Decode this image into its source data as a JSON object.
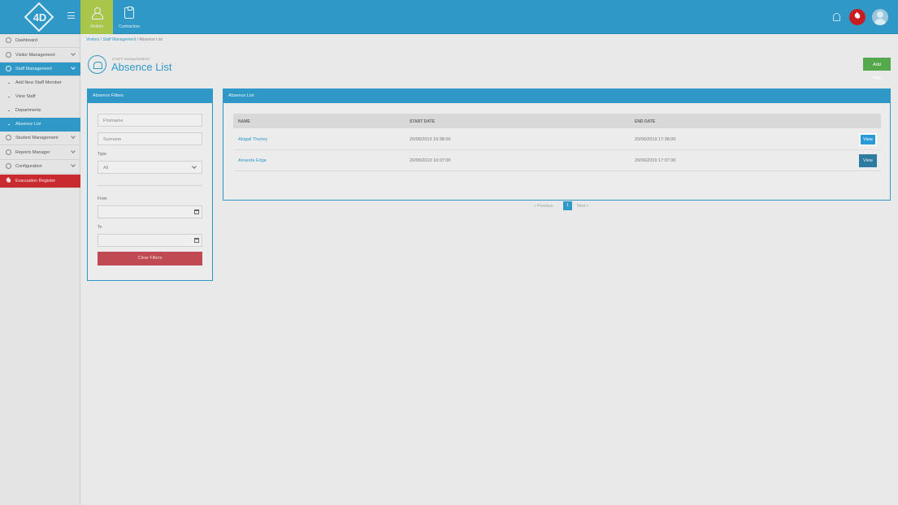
{
  "topbar": {
    "logo": "4D",
    "nav": [
      {
        "label": "Visitors"
      },
      {
        "label": "Contractors"
      }
    ]
  },
  "sidebar": {
    "items": [
      {
        "label": "Dashboard"
      },
      {
        "label": "Visitor Management"
      },
      {
        "label": "Staff Management"
      },
      {
        "label": "Student Management"
      },
      {
        "label": "Reports Manager"
      },
      {
        "label": "Configuration"
      },
      {
        "label": "Evacuation Register"
      }
    ],
    "sub_items": [
      {
        "label": "Add New Staff Member"
      },
      {
        "label": "View Staff"
      },
      {
        "label": "Departments"
      },
      {
        "label": "Absence List"
      }
    ]
  },
  "breadcrumb": {
    "items": [
      "Visitors",
      "Staff Management",
      "Absence List"
    ],
    "separator": "/"
  },
  "page": {
    "subtitle": "STAFF MANAGEMENT",
    "title": "Absence List",
    "add_new_label": "Add New"
  },
  "filters": {
    "title": "Absence Filters",
    "firstname_placeholder": "Firstname",
    "surname_placeholder": "Surname",
    "type_label": "Type",
    "type_value": "All",
    "from_label": "From",
    "to_label": "To",
    "clear_label": "Clear Filters"
  },
  "list": {
    "title": "Absence List",
    "columns": [
      "NAME",
      "START DATE",
      "END DATE"
    ],
    "rows": [
      {
        "name": "Abigail Thorley",
        "start": "20/06/2019 16:38:00",
        "end": "20/06/2019 17:38:00",
        "action": "View"
      },
      {
        "name": "Amanda Edge",
        "start": "20/06/2019 16:07:00",
        "end": "20/06/2019 17:07:00",
        "action": "View"
      }
    ],
    "pagination": {
      "prev": "« Previous",
      "current": "1",
      "next": "Next »"
    }
  },
  "colors": {
    "primary": "#2f98c6",
    "accent_green": "#a8c64a",
    "add_new": "#56a84d",
    "danger": "#c92a2f"
  }
}
